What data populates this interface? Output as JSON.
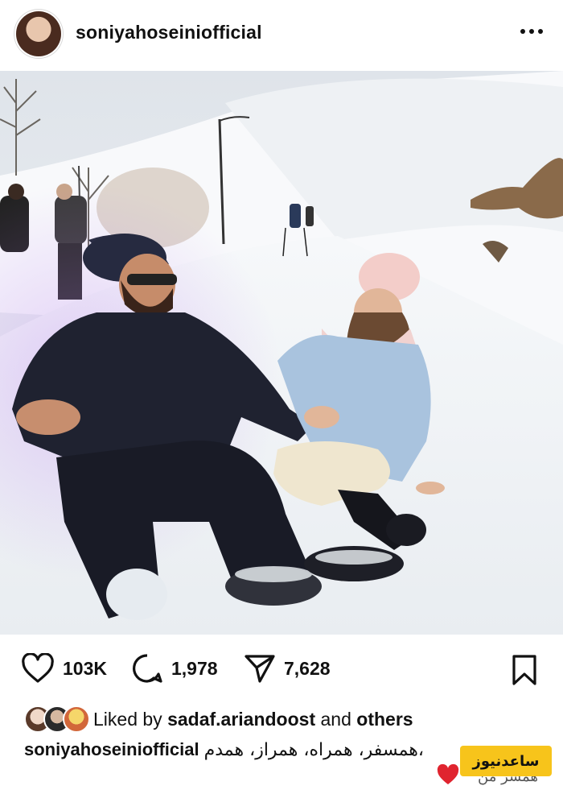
{
  "post": {
    "username": "soniyahoseiniofficial",
    "more_icon": "more-horizontal-icon",
    "photo_description_icon": "photo",
    "stats": {
      "likes": "103K",
      "comments": "1,978",
      "shares": "7,628"
    },
    "liked_by": {
      "prefix": "Liked by",
      "user": "sadaf.ariandoost",
      "and": "and",
      "others": "others"
    },
    "caption": {
      "user": "soniyahoseiniofficial",
      "text": "همسفر، همراه، همراز، همدم،",
      "second_line_fragment": "همسر من"
    },
    "watermark": "ساعدنیوز"
  },
  "colors": {
    "snow": "#f4f6f8",
    "jacket_dark": "#1f2230",
    "denim": "#a9c3de",
    "scarf": "#f1d2d0",
    "hat_pink": "#f3cdc9",
    "watermark_bg": "#f7c41b",
    "heart": "#e0242f"
  }
}
